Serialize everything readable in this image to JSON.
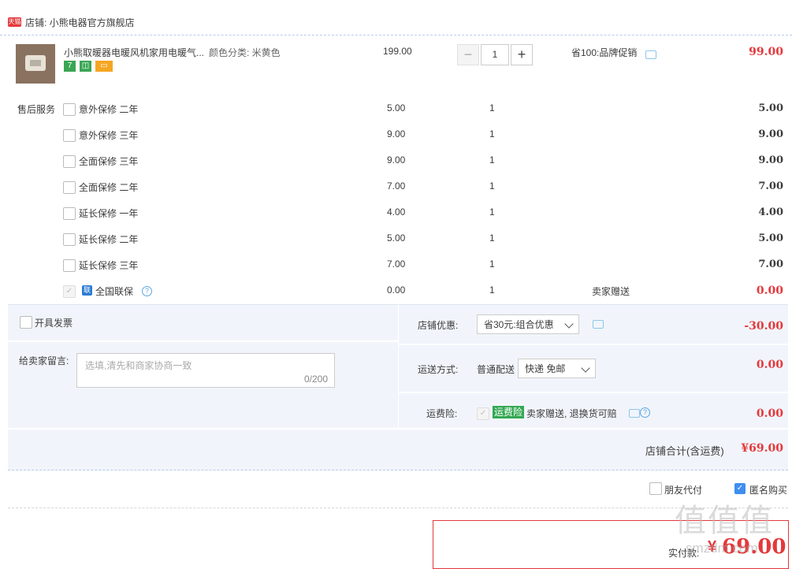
{
  "shop": {
    "badge": "天猫",
    "label": "店铺: 小熊电器官方旗舰店"
  },
  "product": {
    "title": "小熊取暖器电暖风机家用电暖气...",
    "spec": "颜色分类: 米黄色",
    "unit_price": "199.00",
    "quantity": "1",
    "minus": "−",
    "plus": "+",
    "promo": "省100:品牌促销",
    "subtotal": "99.00",
    "tags": [
      {
        "text": "7",
        "color": "#3aa654"
      },
      {
        "text": "◫",
        "color": "#3aa654"
      },
      {
        "text": "▭",
        "color": "#f5a623"
      }
    ]
  },
  "services": {
    "label": "售后服务",
    "items": [
      {
        "name": "意外保修 二年",
        "price": "5.00",
        "qty": "1",
        "note": "",
        "amount": "5.00"
      },
      {
        "name": "意外保修 三年",
        "price": "9.00",
        "qty": "1",
        "note": "",
        "amount": "9.00"
      },
      {
        "name": "全面保修 三年",
        "price": "9.00",
        "qty": "1",
        "note": "",
        "amount": "9.00"
      },
      {
        "name": "全面保修 二年",
        "price": "7.00",
        "qty": "1",
        "note": "",
        "amount": "7.00"
      },
      {
        "name": "延长保修 一年",
        "price": "4.00",
        "qty": "1",
        "note": "",
        "amount": "4.00"
      },
      {
        "name": "延长保修 二年",
        "price": "5.00",
        "qty": "1",
        "note": "",
        "amount": "5.00"
      },
      {
        "name": "延长保修 三年",
        "price": "7.00",
        "qty": "1",
        "note": "",
        "amount": "7.00"
      }
    ],
    "lianbao": {
      "badge": "联",
      "name": "全国联保",
      "help": "?",
      "price": "0.00",
      "qty": "1",
      "note": "卖家赠送",
      "amount": "0.00"
    }
  },
  "invoice": {
    "label": "开具发票"
  },
  "message": {
    "label": "给卖家留言:",
    "placeholder": "选填,清先和商家协商一致",
    "counter": "0/200"
  },
  "shop_discount": {
    "label": "店铺优惠:",
    "value": "省30元:组合优惠",
    "amount": "-30.00"
  },
  "shipping": {
    "label": "运送方式:",
    "method": "普通配送",
    "value": "快递 免邮",
    "amount": "0.00"
  },
  "freight_insurance": {
    "label": "运费险:",
    "tag": "运费险",
    "text": "卖家赠送, 退换货可赔",
    "help": "?",
    "amount": "0.00"
  },
  "shop_total": {
    "label": "店铺合计(含运费)",
    "amount": "¥69.00"
  },
  "options": {
    "friend_pay": "朋友代付",
    "anonymous": "匿名购买",
    "check": "✓"
  },
  "payment": {
    "label": "实付款:",
    "currency": "¥",
    "amount": "69.00"
  },
  "watermark": {
    "logo": "值值值",
    "site": "smzdm.com"
  }
}
